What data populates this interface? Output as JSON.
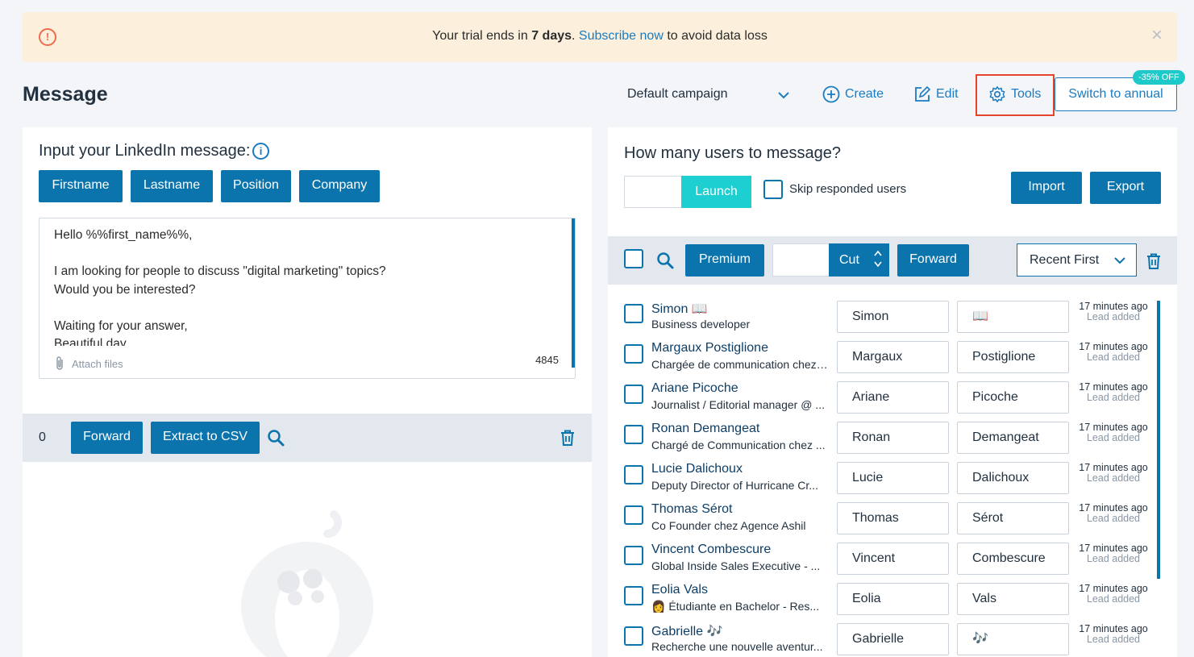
{
  "banner": {
    "text_before": "Your trial ends in ",
    "days": "7 days",
    "dot": ".",
    "subscribe_link": "Subscribe now",
    "text_after": " to avoid data loss",
    "warn_glyph": "!",
    "close_glyph": "×"
  },
  "header": {
    "title": "Message",
    "campaign_select": "Default campaign",
    "create_label": "Create",
    "edit_label": "Edit",
    "tools_label": "Tools",
    "annual_label": "Switch to annual",
    "annual_badge": "-35% OFF"
  },
  "composer": {
    "title": "Input your LinkedIn message:",
    "info_glyph": "i",
    "variables": [
      "Firstname",
      "Lastname",
      "Position",
      "Company"
    ],
    "message_lines": [
      "Hello %%first_name%%,",
      "",
      "I am looking for people to discuss \"digital marketing\" topics?",
      "Would you be interested?",
      "",
      "Waiting for your answer,",
      "Beautiful day."
    ],
    "attach_label": "Attach files",
    "char_count": "4845"
  },
  "selection_bar": {
    "count": "0",
    "forward_label": "Forward",
    "extract_label": "Extract to CSV"
  },
  "audience": {
    "title": "How many users to message?",
    "count_value": "",
    "launch_label": "Launch",
    "skip_label": "Skip responded users",
    "import_label": "Import",
    "export_label": "Export"
  },
  "list_toolbar": {
    "premium_label": "Premium",
    "cut_value": "",
    "cut_label": "Cut",
    "forward_label": "Forward",
    "sort_label": "Recent First"
  },
  "users": [
    {
      "name": "Simon 📖",
      "title": "Business developer",
      "first": "Simon",
      "last": "📖",
      "time": "17 minutes ago",
      "status": "Lead added"
    },
    {
      "name": "Margaux Postiglione",
      "title": "Chargée de communication chez ...",
      "first": "Margaux",
      "last": "Postiglione",
      "time": "17 minutes ago",
      "status": "Lead added"
    },
    {
      "name": "Ariane Picoche",
      "title": "Journalist / Editorial manager @ ...",
      "first": "Ariane",
      "last": "Picoche",
      "time": "17 minutes ago",
      "status": "Lead added"
    },
    {
      "name": "Ronan Demangeat",
      "title": "Chargé de Communication chez ...",
      "first": "Ronan",
      "last": "Demangeat",
      "time": "17 minutes ago",
      "status": "Lead added"
    },
    {
      "name": "Lucie Dalichoux",
      "title": "Deputy Director of Hurricane Cr...",
      "first": "Lucie",
      "last": "Dalichoux",
      "time": "17 minutes ago",
      "status": "Lead added"
    },
    {
      "name": "Thomas Sérot",
      "title": "Co Founder chez Agence Ashil",
      "first": "Thomas",
      "last": "Sérot",
      "time": "17 minutes ago",
      "status": "Lead added"
    },
    {
      "name": "Vincent Combescure",
      "title": "Global Inside Sales Executive - ...",
      "first": "Vincent",
      "last": "Combescure",
      "time": "17 minutes ago",
      "status": "Lead added"
    },
    {
      "name": "Eolia Vals",
      "title": "👩 Étudiante en Bachelor - Res...",
      "first": "Eolia",
      "last": "Vals",
      "time": "17 minutes ago",
      "status": "Lead added"
    },
    {
      "name": "Gabrielle 🎶",
      "title": "Recherche une nouvelle aventur...",
      "first": "Gabrielle",
      "last": "🎶",
      "time": "17 minutes ago",
      "status": "Lead added"
    }
  ],
  "colors": {
    "primary": "#0b74ad",
    "link": "#1a7bc1",
    "launch": "#1ecfd2",
    "banner_bg": "#fcf0dd",
    "warning": "#ef6b4a",
    "highlight": "#e3442b"
  }
}
